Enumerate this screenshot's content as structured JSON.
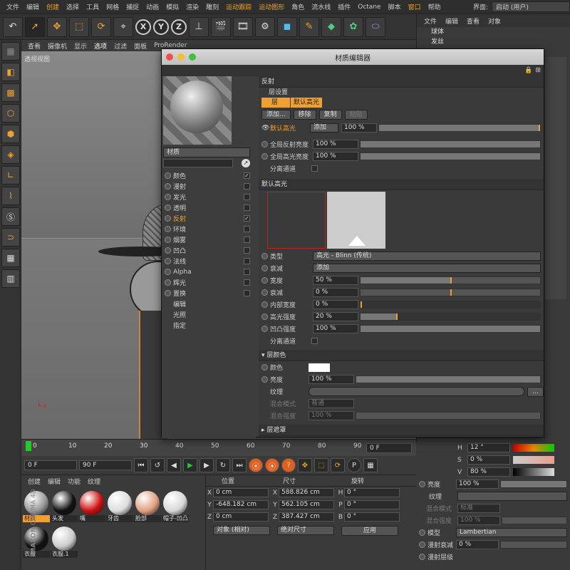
{
  "menubar": {
    "items": [
      "文件",
      "编辑",
      "创建",
      "选择",
      "工具",
      "网格",
      "捕捉",
      "动画",
      "模拟",
      "渲染",
      "雕刻",
      "运动跟踪",
      "运动图形",
      "角色",
      "流水线",
      "插件",
      "Octane",
      "脚本",
      "窗口",
      "帮助"
    ],
    "interface_label": "界面:",
    "interface_value": "启动 (用户)"
  },
  "toolbar": {
    "buttons": [
      "undo-icon",
      "move-icon",
      "scale-icon",
      "rotate-icon",
      "select-icon",
      "x-axis",
      "y-axis",
      "z-axis",
      "world-icon",
      "render-icon",
      "render-view-icon",
      "render-settings-icon",
      "cube-icon",
      "pen-icon",
      "subdivision-icon",
      "cloner-icon",
      "deformer-icon"
    ],
    "x_label": "X",
    "y_label": "Y",
    "z_label": "Z"
  },
  "viewport": {
    "menu": [
      "查看",
      "摄像机",
      "显示",
      "选项",
      "过滤",
      "面板",
      "ProRender"
    ],
    "label": "透视视图"
  },
  "objects_panel": {
    "menu": [
      "文件",
      "编辑",
      "查看",
      "对象"
    ],
    "items": [
      "球体",
      "发丝"
    ]
  },
  "timeline": {
    "ticks": [
      "0",
      "10",
      "20",
      "30",
      "40",
      "50",
      "60",
      "70",
      "80",
      "90"
    ],
    "frame_end": "0 F"
  },
  "playback": {
    "start_frame": "0 F",
    "end_frame": "90 F"
  },
  "material_manager": {
    "menu": [
      "创建",
      "编辑",
      "功能",
      "纹理"
    ],
    "materials": [
      {
        "name": "材质",
        "color": "#9a9a9a",
        "selected": true
      },
      {
        "name": "头发",
        "color": "#111111",
        "selected": false
      },
      {
        "name": "嘴",
        "color": "#cc1010",
        "selected": false
      },
      {
        "name": "牙齿",
        "color": "#dddddd",
        "selected": false
      },
      {
        "name": "脸部",
        "color": "#e0a080",
        "selected": false
      },
      {
        "name": "帽子-凹凸",
        "color": "#d8d8d8",
        "selected": false
      },
      {
        "name": "衣服",
        "color": "#111111",
        "selected": false
      },
      {
        "name": "衣服.1",
        "color": "#cccccc",
        "selected": false
      }
    ],
    "brand1": "MAXON",
    "brand2": "CINEMA 4D"
  },
  "coordinates": {
    "headers": [
      "位置",
      "尺寸",
      "旋转"
    ],
    "rows": [
      {
        "axis": "X",
        "pos": "0 cm",
        "size": "588.826 cm",
        "rot_label": "H",
        "rot": "0 °"
      },
      {
        "axis": "Y",
        "pos": "-648.182 cm",
        "size": "562.105 cm",
        "rot_label": "P",
        "rot": "0 °"
      },
      {
        "axis": "Z",
        "pos": "0 cm",
        "size": "387.427 cm",
        "rot_label": "B",
        "rot": "0 °"
      }
    ],
    "mode1": "对象 (相对)",
    "mode2": "绝对尺寸",
    "apply": "应用"
  },
  "attributes": {
    "h_label": "H",
    "h_value": "12 °",
    "s_label": "S",
    "s_value": "0 %",
    "v_label": "V",
    "v_value": "80 %",
    "brightness_label": "亮度",
    "brightness_value": "100 %",
    "texture_label": "纹理",
    "mix_mode_label": "混合模式",
    "mix_mode_value": "标准",
    "mix_strength_label": "混合强度",
    "mix_strength_value": "100 %",
    "model_label": "模型",
    "model_value": "Lambertian",
    "diffuse_falloff_label": "漫射衰减",
    "diffuse_falloff_value": "0 %",
    "diffuse_level_label": "漫射层级"
  },
  "material_editor": {
    "title": "材质编辑器",
    "name_field": "材质",
    "channels": [
      {
        "label": "颜色",
        "checked": true,
        "active": false
      },
      {
        "label": "漫射",
        "checked": false,
        "active": false
      },
      {
        "label": "发光",
        "checked": false,
        "active": false
      },
      {
        "label": "透明",
        "checked": false,
        "active": false
      },
      {
        "label": "反射",
        "checked": true,
        "active": true
      },
      {
        "label": "环境",
        "checked": false,
        "active": false
      },
      {
        "label": "烟雾",
        "checked": false,
        "active": false
      },
      {
        "label": "凹凸",
        "checked": false,
        "active": false
      },
      {
        "label": "法线",
        "checked": false,
        "active": false
      },
      {
        "label": "Alpha",
        "checked": false,
        "active": false
      },
      {
        "label": "辉光",
        "checked": false,
        "active": false
      },
      {
        "label": "置换",
        "checked": false,
        "active": false
      }
    ],
    "extras": [
      "编辑",
      "光照",
      "指定"
    ],
    "section_reflect": "反射",
    "layer_settings": "层设置",
    "tab_layer": "层",
    "tab_default_spec": "默认高光",
    "btn_add": "添加...",
    "btn_remove": "移除",
    "btn_copy": "复制",
    "btn_paste": "粘贴",
    "layer_name": "默认高光",
    "layer_mode": "添加",
    "layer_value": "100 %",
    "global_reflect_label": "全局反射亮度",
    "global_reflect_value": "100 %",
    "global_spec_label": "全局高光亮度",
    "global_spec_value": "100 %",
    "sep_pass_label": "分离通道",
    "section_default_spec": "默认高光",
    "type_label": "类型",
    "type_value": "高光 - Blinn (传统)",
    "attenuation_label": "衰减",
    "attenuation_value": "添加",
    "width_label": "宽度",
    "width_value": "50 %",
    "width_pct": 0.5,
    "falloff_label": "衰减",
    "falloff_value": "0 %",
    "inner_width_label": "内部宽度",
    "inner_width_value": "0 %",
    "spec_strength_label": "高光强度",
    "spec_strength_value": "20 %",
    "spec_strength_pct": 0.2,
    "bump_strength_label": "凹凸强度",
    "bump_strength_value": "100 %",
    "sep_pass2_label": "分离通道",
    "layer_color_section": "层颜色",
    "color_label": "颜色",
    "brightness_label": "亮度",
    "brightness_value": "100 %",
    "texture_label": "纹理",
    "mix_mode_label": "混合模式",
    "mix_mode_value": "普通",
    "mix_strength_label": "混合强度",
    "mix_strength_value": "100 %",
    "layer_mask_section": "层遮罩"
  }
}
